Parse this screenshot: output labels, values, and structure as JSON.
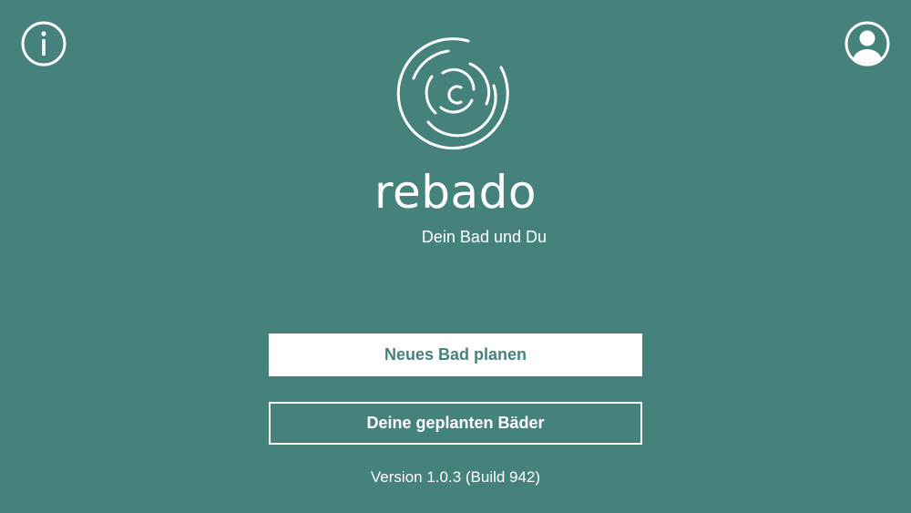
{
  "theme": {
    "background": "#45827b",
    "foreground": "#ffffff",
    "accent": "#45827b"
  },
  "header": {
    "info_icon": "info-circle-icon",
    "profile_icon": "user-profile-icon"
  },
  "branding": {
    "logo_icon": "rebado-spiral-logo-icon",
    "name": "rebado",
    "tagline": "Dein Bad und Du"
  },
  "actions": {
    "primary_label": "Neues Bad planen",
    "secondary_label": "Deine geplanten Bäder"
  },
  "footer": {
    "version_text": "Version 1.0.3 (Build 942)"
  }
}
